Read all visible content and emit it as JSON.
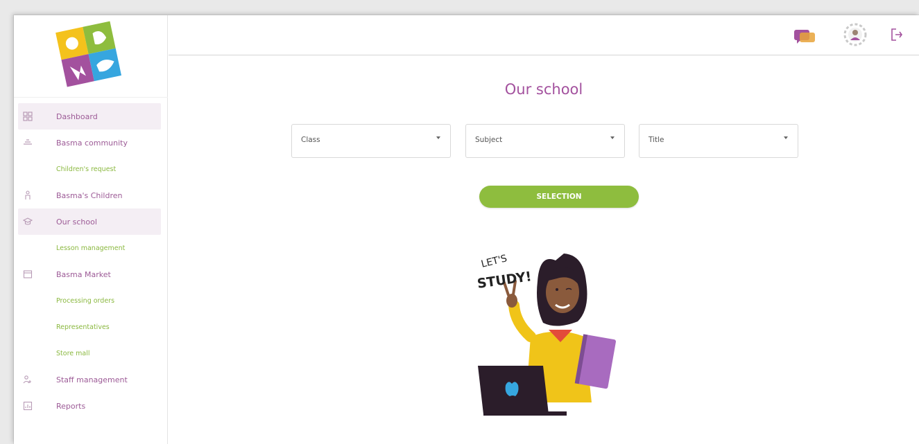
{
  "sidebar": {
    "items": [
      {
        "label": "Dashboard",
        "icon": "grid-icon",
        "active": true,
        "sub": false
      },
      {
        "label": "Basma community",
        "icon": "community-icon",
        "active": false,
        "sub": false
      },
      {
        "label": "Children's request",
        "icon": "",
        "active": false,
        "sub": true
      },
      {
        "label": "Basma's Children",
        "icon": "child-icon",
        "active": false,
        "sub": false
      },
      {
        "label": "Our school",
        "icon": "graduation-cap-icon",
        "active": true,
        "sub": false
      },
      {
        "label": "Lesson management",
        "icon": "",
        "active": false,
        "sub": true
      },
      {
        "label": "Basma Market",
        "icon": "store-icon",
        "active": false,
        "sub": false
      },
      {
        "label": "Processing orders",
        "icon": "",
        "active": false,
        "sub": true
      },
      {
        "label": "Representatives",
        "icon": "",
        "active": false,
        "sub": true
      },
      {
        "label": "Store mall",
        "icon": "",
        "active": false,
        "sub": true
      },
      {
        "label": "Staff management",
        "icon": "users-icon",
        "active": false,
        "sub": false
      },
      {
        "label": "Reports",
        "icon": "report-icon",
        "active": false,
        "sub": false
      }
    ]
  },
  "topbar": {
    "icons": [
      "chat-icon",
      "profile-settings-icon",
      "logout-icon"
    ]
  },
  "main": {
    "title": "Our school",
    "filters": [
      {
        "label": "Class"
      },
      {
        "label": "Subject"
      },
      {
        "label": "Title"
      }
    ],
    "selection_button": "SELECTION",
    "illustration_text_1": "LET'S",
    "illustration_text_2": "STUDY!"
  },
  "colors": {
    "brand_purple": "#a3519e",
    "accent_green": "#8ebd3e",
    "active_bg": "#f4eef4"
  }
}
